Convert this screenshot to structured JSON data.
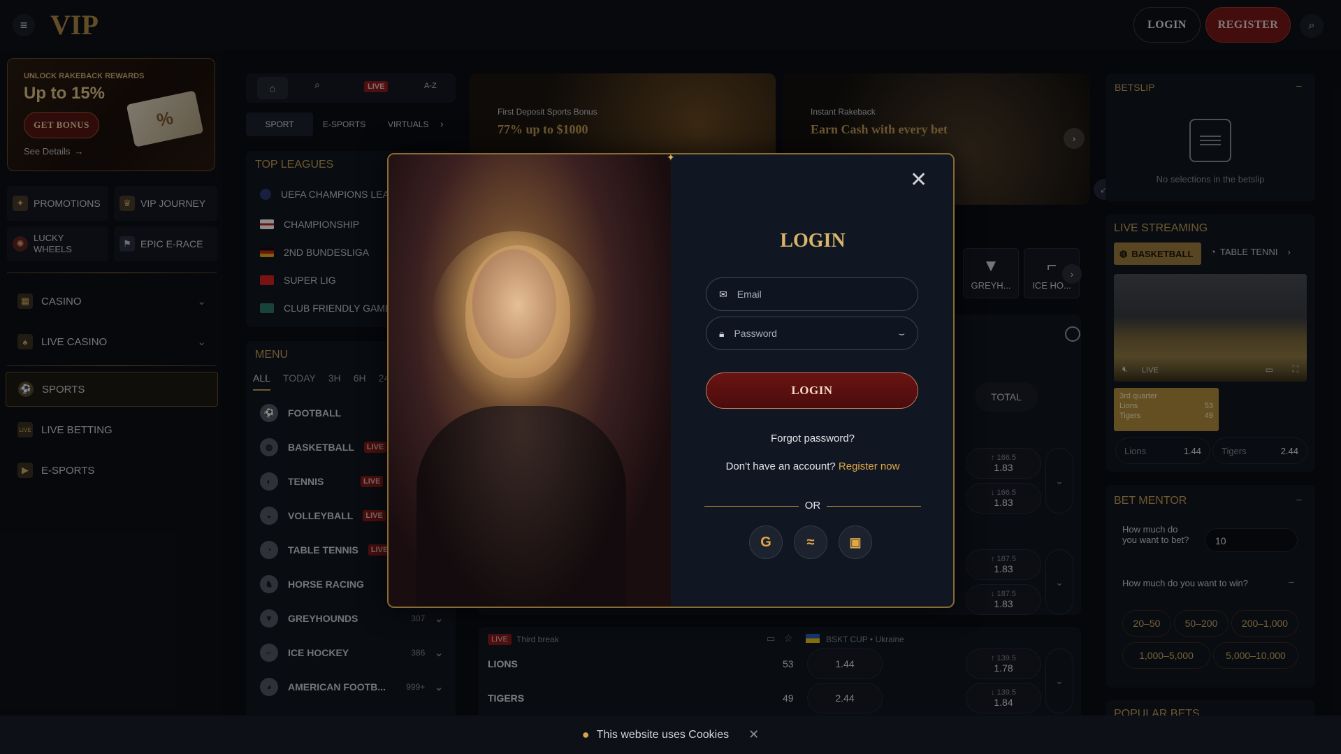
{
  "header": {
    "logo": "VIP",
    "login": "LOGIN",
    "register": "REGISTER"
  },
  "promo": {
    "kicker": "UNLOCK RAKEBACK REWARDS",
    "headline": "Up to 15%",
    "button": "GET BONUS",
    "details": "See Details"
  },
  "left_nav": {
    "tiles": [
      "PROMOTIONS",
      "VIP JOURNEY",
      "LUCKY WHEELS",
      "EPIC E-RACE"
    ],
    "items": [
      "CASINO",
      "LIVE CASINO",
      "SPORTS",
      "LIVE BETTING",
      "E-SPORTS"
    ]
  },
  "sport_tabs": {
    "live": "LIVE",
    "az": "A-Z",
    "tabs": [
      "SPORT",
      "E-SPORTS",
      "VIRTUALS"
    ]
  },
  "top_leagues": {
    "title": "TOP LEAGUES",
    "items": [
      "UEFA CHAMPIONS LEA",
      "CHAMPIONSHIP",
      "2ND BUNDESLIGA",
      "SUPER LIG",
      "CLUB FRIENDLY GAMES"
    ]
  },
  "menu": {
    "title": "MENU",
    "filters": [
      "ALL",
      "TODAY",
      "3H",
      "6H",
      "24"
    ],
    "sports": [
      {
        "name": "FOOTBALL",
        "badge": "",
        "count": ""
      },
      {
        "name": "BASKETBALL",
        "badge": "LIVE",
        "count": ""
      },
      {
        "name": "TENNIS",
        "badge": "LIVE",
        "count": ""
      },
      {
        "name": "VOLLEYBALL",
        "badge": "LIVE",
        "count": ""
      },
      {
        "name": "TABLE TENNIS",
        "badge": "LIVE",
        "count": ""
      },
      {
        "name": "HORSE RACING",
        "badge": "",
        "count": ""
      },
      {
        "name": "GREYHOUNDS",
        "badge": "",
        "count": "307"
      },
      {
        "name": "ICE HOCKEY",
        "badge": "",
        "count": "386"
      },
      {
        "name": "AMERICAN FOOTB...",
        "badge": "",
        "count": "999+"
      }
    ]
  },
  "banners": [
    {
      "kicker": "First Deposit Sports Bonus",
      "headline": "77% up to $1000"
    },
    {
      "kicker": "Instant Rakeback",
      "headline": "Earn Cash with every bet"
    }
  ],
  "sport_icons": [
    "GREYH...",
    "ICE HO..."
  ],
  "total_label": "TOTAL",
  "odds_rows": [
    {
      "top": "↑ 166.5",
      "top_val": "1.83",
      "bottom": "↓ 166.5",
      "bottom_val": "1.83"
    },
    {
      "top": "↑ 187.5",
      "top_val": "1.83",
      "bottom": "↓ 187.5",
      "bottom_val": "1.83"
    }
  ],
  "live_match": {
    "live": "LIVE",
    "status": "Third break",
    "competition": "BSKT CUP • Ukraine",
    "teams": [
      {
        "name": "LIONS",
        "score": "53",
        "odds": "1.44",
        "total": "↑ 139.5",
        "total_val": "1.78"
      },
      {
        "name": "TIGERS",
        "score": "49",
        "odds": "2.44",
        "total": "↓ 139.5",
        "total_val": "1.84"
      }
    ]
  },
  "betslip": {
    "title": "BETSLIP",
    "empty": "No selections in the betslip"
  },
  "live_streaming": {
    "title": "LIVE STREAMING",
    "tabs": [
      "BASKETBALL",
      "TABLE TENNI"
    ],
    "live": "LIVE",
    "quarter": "3rd quarter",
    "team1": "Lions",
    "score1": "53",
    "team2": "Tigers",
    "score2": "49",
    "odds1": "1.44",
    "odds2": "2.44"
  },
  "bet_mentor": {
    "title": "BET MENTOR",
    "q1": "How much do you want to bet?",
    "bet_value": "10",
    "q2": "How much do you want to win?",
    "ranges": [
      "20–50",
      "50–200",
      "200–1,000",
      "1,000–5,000",
      "5,000–10,000"
    ],
    "popular": "POPULAR BETS"
  },
  "login_modal": {
    "title": "LOGIN",
    "email_placeholder": "Email",
    "password_placeholder": "Password",
    "submit": "LOGIN",
    "forgot": "Forgot password?",
    "no_account": "Don't have an account?",
    "register": "Register now",
    "or": "OR"
  },
  "cookie": {
    "text": "This website uses Cookies"
  },
  "colors": {
    "accent_gold": "#c9a25a",
    "brand_red": "#8e1c1c",
    "live_red": "#b3262a"
  }
}
